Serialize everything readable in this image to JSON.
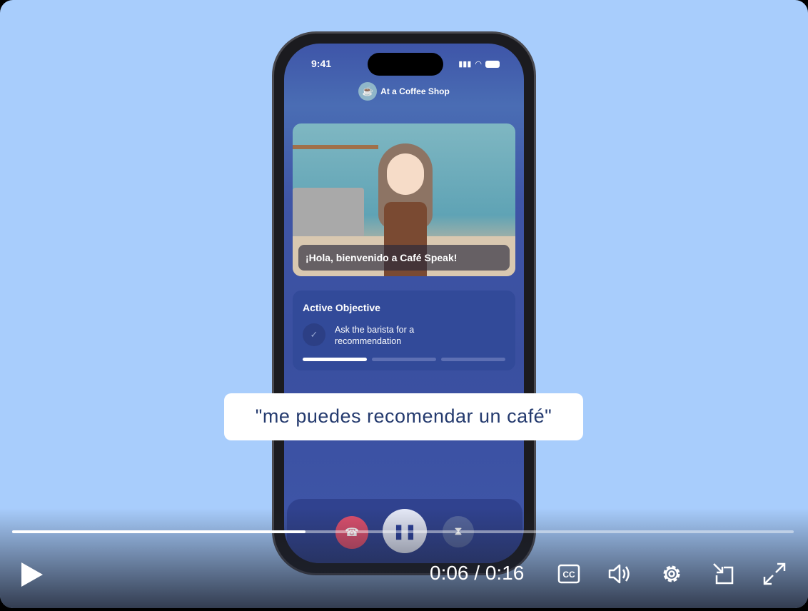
{
  "phone": {
    "status_time": "9:41",
    "scenario_title": "At a Coffee Shop",
    "scene_caption": "¡Hola, bienvenido a Café Speak!",
    "objective": {
      "heading": "Active Objective",
      "text": "Ask the barista for a recommendation",
      "segments_complete": 1,
      "segments_total": 3
    },
    "controls": [
      "end-call",
      "pause",
      "hourglass"
    ]
  },
  "subtitle": "\"me puedes recomendar un café\"",
  "player": {
    "current_time": "0:06",
    "duration": "0:16",
    "time_display": "0:06 / 0:16",
    "progress_percent": 37.5
  },
  "colors": {
    "background": "#a8cdfc",
    "end_call": "#e0506e",
    "subtitle_text": "#243a6e"
  }
}
